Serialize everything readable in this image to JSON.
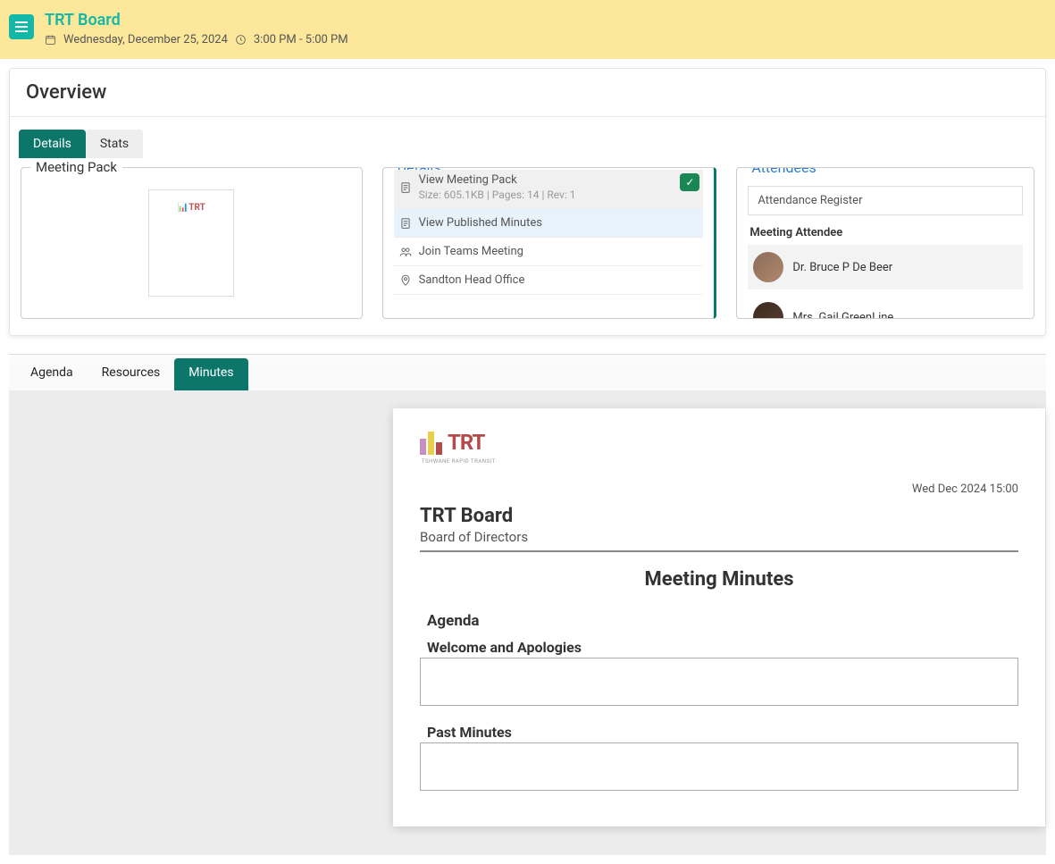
{
  "header": {
    "title": "TRT Board",
    "date": "Wednesday, December 25, 2024",
    "time": "3:00 PM - 5:00 PM"
  },
  "overview": {
    "title": "Overview",
    "tabs": {
      "details": "Details",
      "stats": "Stats"
    },
    "meeting_pack": {
      "legend": "Meeting Pack",
      "logo": "📊TRT"
    },
    "details": {
      "legend": "Details",
      "view_pack": "View Meeting Pack",
      "pack_meta": "Size: 605.1KB | Pages: 14 | Rev: 1",
      "view_minutes": "View Published Minutes",
      "teams": "Join Teams Meeting",
      "location": "Sandton Head Office"
    },
    "attendees": {
      "legend": "Attendees",
      "register": "Attendance Register",
      "section": "Meeting Attendee",
      "list": [
        {
          "name": "Dr. Bruce P De Beer"
        },
        {
          "name": "Mrs. Gail GreenLine"
        }
      ]
    }
  },
  "subTabs": {
    "agenda": "Agenda",
    "resources": "Resources",
    "minutes": "Minutes"
  },
  "doc": {
    "logo_text": "TRT",
    "logo_sub": "TSHWANE RAPID TRANSIT",
    "datetime": "Wed Dec 2024 15:00",
    "title": "TRT Board",
    "subtitle": "Board of Directors",
    "heading": "Meeting Minutes",
    "section_agenda": "Agenda",
    "item1": "Welcome and Apologies",
    "item2": "Past Minutes"
  }
}
